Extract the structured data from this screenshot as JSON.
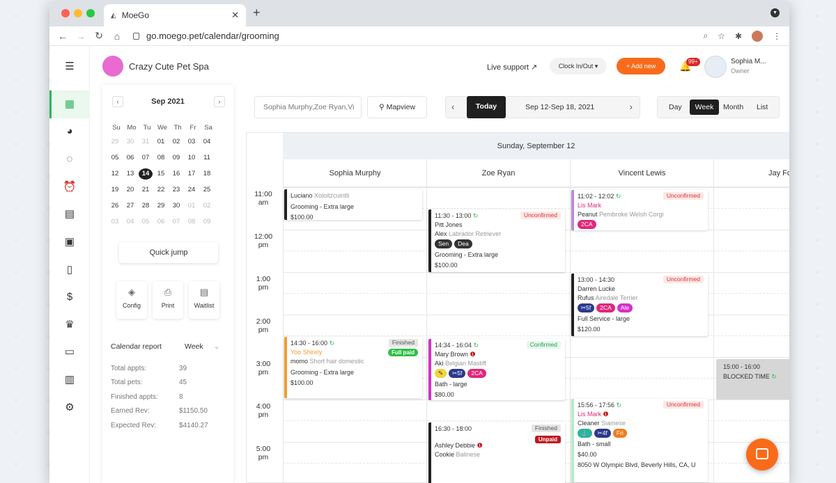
{
  "browser": {
    "tab_title": "MoeGo",
    "url": "go.moego.pet/calendar/grooming",
    "profile_initial": "▼"
  },
  "header": {
    "business_name": "Crazy Cute Pet Spa",
    "live_support": "Live support",
    "clock_in_out": "Clock In/Out",
    "add_new": "+ Add new",
    "notif_badge": "99+",
    "user_name": "Sophia M...",
    "user_role": "Owner"
  },
  "mini_calendar": {
    "month_label": "Sep 2021",
    "weekdays": [
      "Su",
      "Mo",
      "Tu",
      "We",
      "Th",
      "Fr",
      "Sa"
    ],
    "weeks": [
      [
        "29",
        "30",
        "31",
        "01",
        "02",
        "03",
        "04"
      ],
      [
        "05",
        "06",
        "07",
        "08",
        "09",
        "10",
        "11"
      ],
      [
        "12",
        "13",
        "14",
        "15",
        "16",
        "17",
        "18"
      ],
      [
        "19",
        "20",
        "21",
        "22",
        "23",
        "24",
        "25"
      ],
      [
        "26",
        "27",
        "28",
        "29",
        "30",
        "01",
        "02"
      ],
      [
        "03",
        "04",
        "05",
        "06",
        "07",
        "08",
        "09"
      ]
    ],
    "selected": "14",
    "quick_jump": "Quick jump"
  },
  "tools": [
    "Config",
    "Print",
    "Waitlist"
  ],
  "report": {
    "title": "Calendar report",
    "period": "Week",
    "stats": [
      {
        "label": "Total appts:",
        "value": "39"
      },
      {
        "label": "Total pets:",
        "value": "45"
      },
      {
        "label": "Finished appts:",
        "value": "8"
      },
      {
        "label": "Earned Rev:",
        "value": "$1150.50"
      },
      {
        "label": "Expected Rev:",
        "value": "$4140.27"
      }
    ]
  },
  "toolbar": {
    "staff_filter": "Sophia Murphy,Zoe Ryan,Vi",
    "mapview": "Mapview",
    "today": "Today",
    "range": "Sep 12-Sep 18, 2021",
    "views": [
      "Day",
      "Week",
      "Month",
      "List"
    ],
    "active_view": "Week"
  },
  "calendar": {
    "day_header": "Sunday, September 12",
    "staff": [
      "Sophia Murphy",
      "Zoe Ryan",
      "Vincent Lewis",
      "Jay Fo"
    ],
    "times": [
      {
        "h": "11:00",
        "p": "am"
      },
      {
        "h": "12:00",
        "p": "pm"
      },
      {
        "h": "1:00",
        "p": "pm"
      },
      {
        "h": "2:00",
        "p": "pm"
      },
      {
        "h": "3:00",
        "p": "pm"
      },
      {
        "h": "4:00",
        "p": "pm"
      },
      {
        "h": "5:00",
        "p": "pm"
      }
    ],
    "events": {
      "e1": {
        "client": "Luciano",
        "pet": "Xoloitzcuintli",
        "service": "Grooming - Extra large",
        "price": "$100.00"
      },
      "e2": {
        "time": "11:30 - 13:00",
        "status": "Unconfirmed",
        "client": "Pitt Jones",
        "pet_name": "Alex",
        "breed": "Labrador Retriever",
        "tags": [
          "Sen",
          "Dea"
        ],
        "service": "Grooming - Extra large",
        "price": "$100.00"
      },
      "e3": {
        "time": "11:02 - 12:02",
        "status": "Unconfirmed",
        "client": "Lis Mark",
        "pet_name": "Peanut",
        "breed": "Pembroke Welsh Corgi",
        "tags": [
          "2CA"
        ]
      },
      "e4": {
        "time": "13:00 - 14:30",
        "status": "Unconfirmed",
        "client": "Darren Lucke",
        "pet_name": "Rufus",
        "breed": "Airedale Terrier",
        "tags": [
          "5f",
          "2CA",
          "Ale"
        ],
        "service": "Full Service - large",
        "price": "$120.00"
      },
      "e5": {
        "time": "14:30 - 16:00",
        "status": "Finished",
        "paid": "Full paid",
        "client": "Yoo Shirely",
        "pet_name": "momo",
        "breed": "Short hair domestic",
        "service": "Grooming - Extra large",
        "price": "$100.00"
      },
      "e6": {
        "time": "14:34 - 16:04",
        "status": "Confirmed",
        "client": "Mary Brown",
        "pet_name": "Aki",
        "breed": "Belgian Mastiff",
        "tags": [
          "5f",
          "2CA"
        ],
        "service": "Bath - large",
        "price": "$80.00"
      },
      "e7": {
        "time": "15:56 - 17:56",
        "status": "Unconfirmed",
        "client": "Lis Mark",
        "pet_name": "Cleaner",
        "breed": "Siamese",
        "tags": [
          "4f",
          "Fri"
        ],
        "service": "Bath - small",
        "price": "$40.00",
        "address": "8050 W Olympic Blvd, Beverly Hills, CA, U"
      },
      "e8": {
        "time": "16:30 - 18:00",
        "status": "Finished",
        "paid": "Unpaid",
        "client": "Ashley Debbie",
        "pet_name": "Cookie",
        "breed": "Balinese"
      },
      "blocked": {
        "time": "15:00 - 16:00",
        "label": "BLOCKED TIME"
      }
    }
  }
}
